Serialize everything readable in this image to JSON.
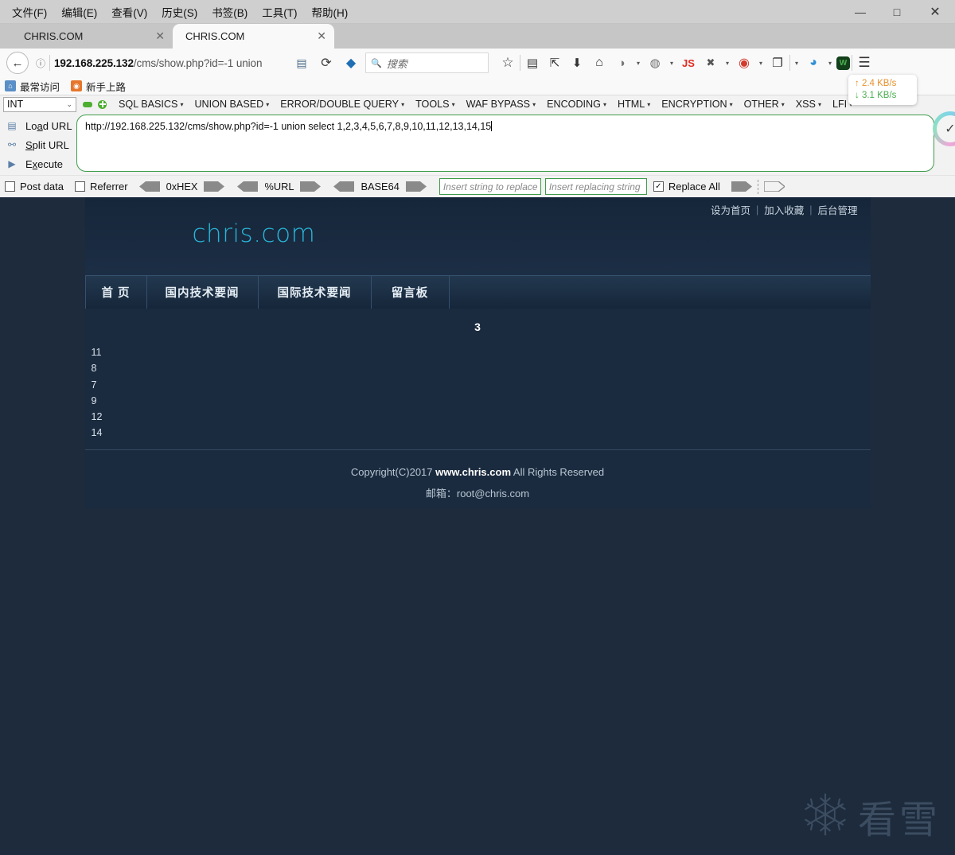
{
  "window": {
    "menus": [
      "文件(F)",
      "编辑(E)",
      "查看(V)",
      "历史(S)",
      "书签(B)",
      "工具(T)",
      "帮助(H)"
    ],
    "minimize": "—",
    "maximize": "□",
    "close": "✕"
  },
  "tabs": [
    {
      "label": "CHRIS.COM",
      "close": "✕",
      "active": false
    },
    {
      "label": "CHRIS.COM",
      "close": "✕",
      "active": true
    }
  ],
  "navbar": {
    "back": "←",
    "info_icon": "ⓘ",
    "url_host": "192.168.225.132",
    "url_path": "/cms/show.php?id=-1 union",
    "reader_icon": "▤",
    "reload_icon": "⟳",
    "pocket_icon": "◆",
    "search_icon": "🔍",
    "search_placeholder": "搜索",
    "star_icon": "☆",
    "library_icon": "▤",
    "save_icon": "⇱",
    "download_icon": "⬇",
    "home_icon": "⌂",
    "palette_icon": "◑",
    "globe_icon": "◍",
    "js_icon": "JS",
    "bug_icon": "✖",
    "lure_icon": "◉",
    "clipboard_icon": "❐",
    "color_icon": "◕",
    "shield_icon": "W",
    "menu_icon": "☰",
    "caret": "▾"
  },
  "bookmarks": [
    {
      "label": "最常访问",
      "icon": "⌂"
    },
    {
      "label": "新手上路",
      "icon": "◉"
    }
  ],
  "hackbar": {
    "select_value": "INT",
    "select_chevron": "⌄",
    "menus": [
      "SQL BASICS",
      "UNION BASED",
      "ERROR/DOUBLE QUERY",
      "TOOLS",
      "WAF BYPASS",
      "ENCODING",
      "HTML",
      "ENCRYPTION",
      "OTHER",
      "XSS",
      "LFI"
    ],
    "menu_caret": "▾",
    "actions": [
      {
        "label_pre": "Lo",
        "label_key": "a",
        "label_post": "d URL",
        "icon": "▤"
      },
      {
        "label_pre": "",
        "label_key": "S",
        "label_post": "plit URL",
        "icon": "⚯"
      },
      {
        "label_pre": "E",
        "label_key": "x",
        "label_post": "ecute",
        "icon": "▶"
      }
    ],
    "url_value": "http://192.168.225.132/cms/show.php?id=-1 union select 1,2,3,4,5,6,7,8,9,10,11,12,13,14,15",
    "post_data_label": "Post data",
    "referrer_label": "Referrer",
    "hex_label": "0xHEX",
    "url_enc_label": "%URL",
    "base64_label": "BASE64",
    "replace_search_placeholder": "Insert string to replace",
    "replace_with_placeholder": "Insert replacing string",
    "replace_all_label": "Replace All",
    "replace_all_checked": "✓"
  },
  "speed": {
    "up": "2.4 KB/s",
    "down": "3.1 KB/s",
    "up_arrow": "↑",
    "down_arrow": "↓"
  },
  "page": {
    "logo": "chris.com",
    "top_links": [
      "设为首页",
      "加入收藏",
      "后台管理"
    ],
    "top_link_sep": "|",
    "nav": [
      "首 页",
      "国内技术要闻",
      "国际技术要闻",
      "留言板"
    ],
    "content_heading": "3",
    "content_list": [
      "11",
      "8",
      "7",
      "9",
      "12",
      "14"
    ],
    "footer_pre": "Copyright(C)2017 ",
    "footer_site": "www.chris.com",
    "footer_post": " All Rights Reserved",
    "footer_email_label": "邮箱：",
    "footer_email": "root@chris.com"
  },
  "watermark": {
    "text": "看雪"
  },
  "colors": {
    "accent_cyan": "#29b6d8",
    "page_bg": "#1b2b3f",
    "viewport_bg": "#1d2b3d",
    "hackbar_green": "#3f9c4a",
    "speed_up": "#e8912d",
    "speed_down": "#4caf50"
  }
}
